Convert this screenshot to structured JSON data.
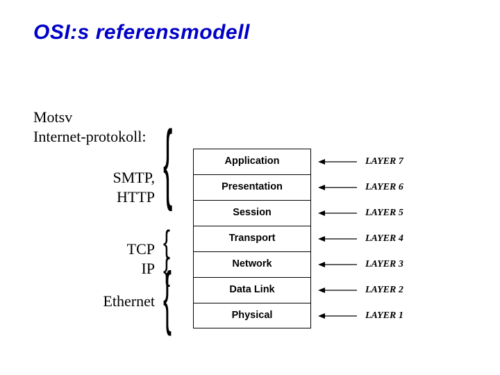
{
  "title": "OSI:s referensmodell",
  "subtitle": "Motsv\nInternet-protokoll:",
  "protocols": {
    "group1": "SMTP,\nHTTP",
    "group2": "TCP\nIP",
    "group3": "Ethernet"
  },
  "layers": [
    {
      "name": "Application",
      "label": "LAYER 7"
    },
    {
      "name": "Presentation",
      "label": "LAYER 6"
    },
    {
      "name": "Session",
      "label": "LAYER 5"
    },
    {
      "name": "Transport",
      "label": "LAYER 4"
    },
    {
      "name": "Network",
      "label": "LAYER 3"
    },
    {
      "name": "Data Link",
      "label": "LAYER 2"
    },
    {
      "name": "Physical",
      "label": "LAYER 1"
    }
  ]
}
